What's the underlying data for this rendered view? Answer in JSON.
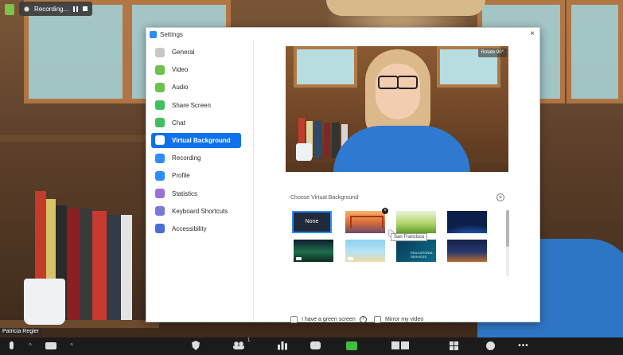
{
  "status": {
    "recording_label": "Recording..."
  },
  "dialog": {
    "title": "Settings",
    "close_glyph": "×"
  },
  "sidebar": {
    "items": [
      {
        "label": "General",
        "icon": "gear-icon",
        "color": "#c7c7c7"
      },
      {
        "label": "Video",
        "icon": "video-icon",
        "color": "#6cc24a"
      },
      {
        "label": "Audio",
        "icon": "headphones-icon",
        "color": "#6cc24a"
      },
      {
        "label": "Share Screen",
        "icon": "share-screen-icon",
        "color": "#3fbf5f"
      },
      {
        "label": "Chat",
        "icon": "chat-icon",
        "color": "#3fbf5f"
      },
      {
        "label": "Virtual Background",
        "icon": "person-icon",
        "color": "#ffffff"
      },
      {
        "label": "Recording",
        "icon": "record-icon",
        "color": "#2d8cff"
      },
      {
        "label": "Profile",
        "icon": "profile-icon",
        "color": "#2d8cff"
      },
      {
        "label": "Statistics",
        "icon": "statistics-icon",
        "color": "#9a6fd6"
      },
      {
        "label": "Keyboard Shortcuts",
        "icon": "keyboard-icon",
        "color": "#7a7ad6"
      },
      {
        "label": "Accessibility",
        "icon": "accessibility-icon",
        "color": "#4b6fd6"
      }
    ],
    "active_item": "Virtual Background",
    "accent_color": "#0e72ed"
  },
  "preview": {
    "rotate_label": "Rotate 90°"
  },
  "virtual_background": {
    "heading": "Choose Virtual Background",
    "add_glyph": "+",
    "none_label": "None",
    "delete_glyph": "×",
    "tooltip": "San Francisco",
    "thumbnails": [
      "None",
      "San Francisco",
      "Grass",
      "Earth",
      "Aurora",
      "Beach",
      "Educational Services",
      "City at night"
    ],
    "edu_caption": "EDUCATIONAL SERVICES"
  },
  "options": {
    "green_screen_label": "I have a green screen",
    "green_screen_checked": false,
    "mirror_label": "Mirror my video",
    "mirror_checked": false,
    "help_glyph": "?"
  },
  "meeting": {
    "participant_name": "Patricia Regier",
    "participant_count": "1",
    "more_glyph": "•••"
  }
}
